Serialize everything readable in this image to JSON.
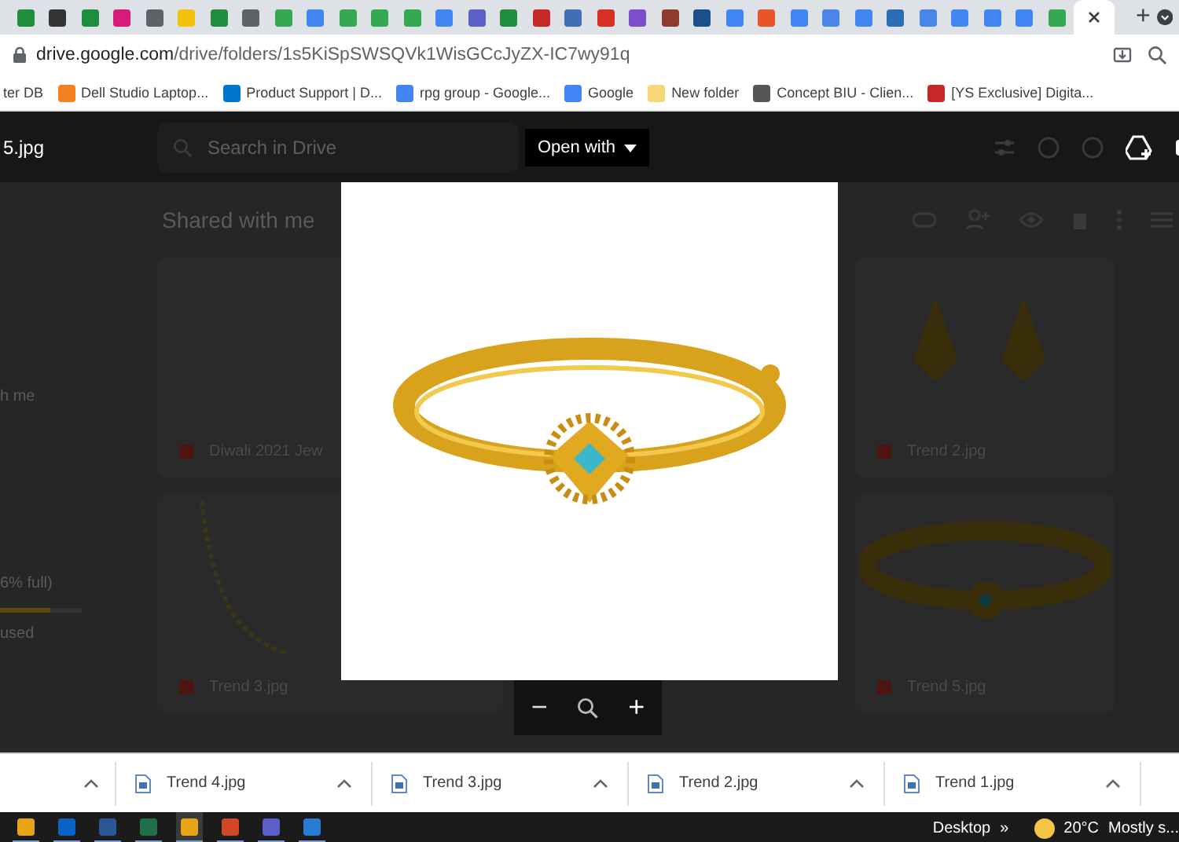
{
  "browser": {
    "tabs": [
      {
        "color": "#1e8e3e",
        "selected": false
      },
      {
        "color": "#333333",
        "selected": false
      },
      {
        "color": "#1e8e3e",
        "selected": false
      },
      {
        "color": "#d81b7a",
        "selected": false
      },
      {
        "color": "#5f6368",
        "selected": false
      },
      {
        "color": "#f4c20d",
        "selected": false
      },
      {
        "color": "#1e8e3e",
        "selected": false
      },
      {
        "color": "#5f6368",
        "selected": false
      },
      {
        "color": "#34a853",
        "selected": false
      },
      {
        "color": "#4285f4",
        "selected": false
      },
      {
        "color": "#34a853",
        "selected": false
      },
      {
        "color": "#34a853",
        "selected": false
      },
      {
        "color": "#34a853",
        "selected": false
      },
      {
        "color": "#4285f4",
        "selected": false
      },
      {
        "color": "#5b5fc7",
        "selected": false
      },
      {
        "color": "#1e8e3e",
        "selected": false
      },
      {
        "color": "#c62828",
        "selected": false
      },
      {
        "color": "#3f6fb5",
        "selected": false
      },
      {
        "color": "#d93025",
        "selected": false
      },
      {
        "color": "#7b4fc9",
        "selected": false
      },
      {
        "color": "#8d3b2f",
        "selected": false
      },
      {
        "color": "#1a4f8a",
        "selected": false
      },
      {
        "color": "#4285f4",
        "selected": false
      },
      {
        "color": "#e8552b",
        "selected": false
      },
      {
        "color": "#4285f4",
        "selected": false
      },
      {
        "color": "#4a86e8",
        "selected": false
      },
      {
        "color": "#4285f4",
        "selected": false
      },
      {
        "color": "#2d6db5",
        "selected": false
      },
      {
        "color": "#4a86e8",
        "selected": false
      },
      {
        "color": "#4285f4",
        "selected": false
      },
      {
        "color": "#4285f4",
        "selected": false
      },
      {
        "color": "#4285f4",
        "selected": false
      },
      {
        "color": "#34a853",
        "selected": false
      },
      {
        "color": "#ffffff",
        "selected": true
      }
    ],
    "new_tab": "+",
    "url_host": "drive.google.com",
    "url_path": "/drive/folders/1s5KiSpSWSQVk1WisGCcJyZX-IC7wy91q",
    "bookmarks": [
      {
        "label": "ter DB"
      },
      {
        "label": "Dell Studio Laptop...",
        "color": "#f4811f"
      },
      {
        "label": "Product Support | D...",
        "color": "#0076ce"
      },
      {
        "label": "rpg group - Google...",
        "color": "#4285f4"
      },
      {
        "label": "Google",
        "color": "#4285f4"
      },
      {
        "label": "New folder",
        "color": "#f7d774"
      },
      {
        "label": "Concept BIU - Clien...",
        "color": "#555555"
      },
      {
        "label": "[YS Exclusive] Digita...",
        "color": "#c62828"
      }
    ]
  },
  "viewer": {
    "file_name": "5.jpg",
    "search_placeholder": "Search in Drive",
    "open_with": "Open with",
    "sidebar": [
      {
        "label": "h me"
      },
      {
        "label": "6% full)"
      },
      {
        "label": "used"
      }
    ],
    "storage": {
      "level": 0.62
    },
    "heading": "Shared with me",
    "cards": [
      {
        "name": "Diwali 2021 Jew",
        "kind": "slides"
      },
      {
        "name": "Trend 2.jpg",
        "kind": "earrings"
      },
      {
        "name": "Trend 3.jpg",
        "kind": "necklace"
      },
      {
        "name": "Trend 5.jpg",
        "kind": "bangle"
      }
    ],
    "zoom_out": "−",
    "zoom_in": "+"
  },
  "downloads": [
    {
      "name": "Trend 4.jpg"
    },
    {
      "name": "Trend 3.jpg"
    },
    {
      "name": "Trend 2.jpg"
    },
    {
      "name": "Trend 1.jpg"
    }
  ],
  "taskbar": {
    "apps": [
      {
        "color": "#e8a317",
        "selected": false
      },
      {
        "color": "#0a64c8",
        "selected": false
      },
      {
        "color": "#2b5797",
        "selected": false
      },
      {
        "color": "#1e7145",
        "selected": false
      },
      {
        "color": "#e8a317",
        "selected": true
      },
      {
        "color": "#d24726",
        "selected": false
      },
      {
        "color": "#5b5fc7",
        "selected": false
      },
      {
        "color": "#2a7bd4",
        "selected": false
      }
    ],
    "desktop": "Desktop",
    "more": "»",
    "temperature": "20°C",
    "weather": "Mostly s..."
  }
}
